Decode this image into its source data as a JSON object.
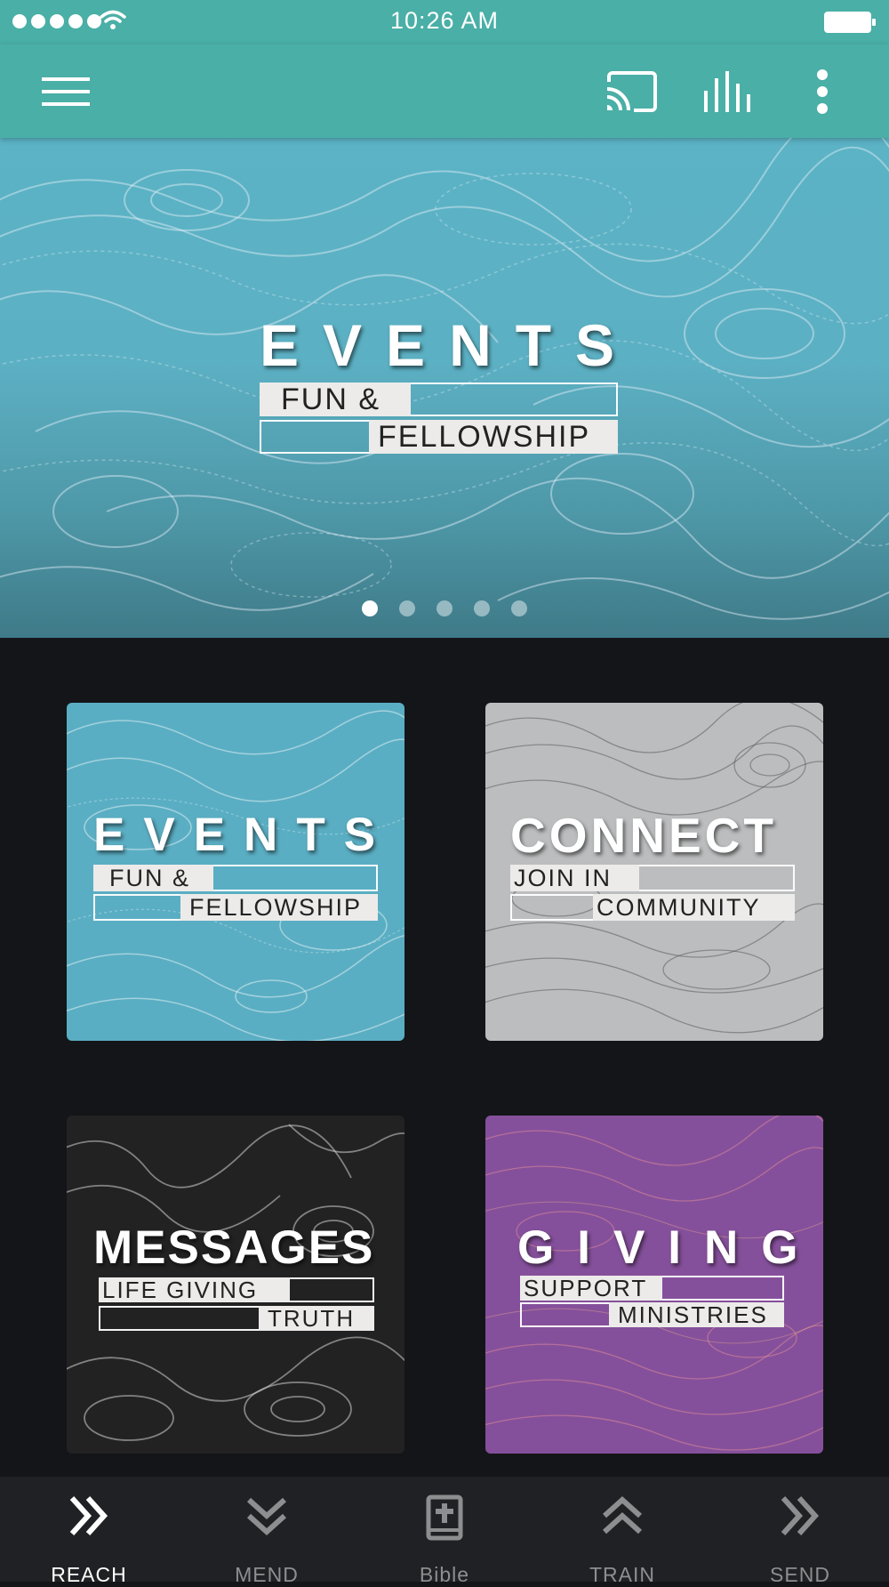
{
  "status_bar": {
    "time": "10:26 AM"
  },
  "app_bar": {
    "menu_icon": "hamburger-menu-icon",
    "cast_icon": "cast-icon",
    "audio_icon": "equalizer-icon",
    "more_icon": "more-vertical-icon",
    "color": "#4aafa6"
  },
  "hero": {
    "title": "EVENTS",
    "line1": "FUN &",
    "line2": "FELLOWSHIP",
    "slide_count": 5,
    "active_slide": 0
  },
  "tiles": [
    {
      "title": "EVENTS",
      "line1": "FUN &",
      "line2": "FELLOWSHIP",
      "color": "#5aaec3"
    },
    {
      "title": "CONNECT",
      "line1": "JOIN IN",
      "line2": "COMMUNITY",
      "color": "#bcbdbe"
    },
    {
      "title": "MESSAGES",
      "line1": "LIFE GIVING",
      "line2": "TRUTH",
      "color": "#222223"
    },
    {
      "title": "GIVING",
      "line1": "SUPPORT",
      "line2": "MINISTRIES",
      "color": "#85509b"
    }
  ],
  "bottom_nav": [
    {
      "label": "REACH",
      "icon": "double-chevron-right-icon",
      "active": true
    },
    {
      "label": "MEND",
      "icon": "double-chevron-down-icon",
      "active": false
    },
    {
      "label": "Bible",
      "icon": "bible-icon",
      "active": false
    },
    {
      "label": "TRAIN",
      "icon": "double-chevron-up-icon",
      "active": false
    },
    {
      "label": "SEND",
      "icon": "double-chevron-right-icon",
      "active": false
    }
  ]
}
